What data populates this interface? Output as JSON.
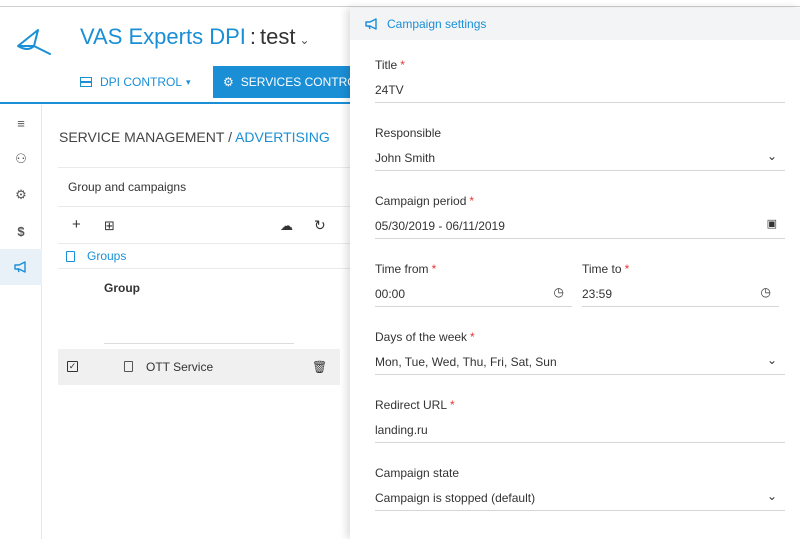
{
  "header": {
    "app_name": "VAS Experts DPI",
    "separator": ":",
    "instance": "test",
    "nav": {
      "dpi_control": "DPI CONTROL",
      "services_control": "SERVICES CONTROL"
    }
  },
  "rail": {
    "items": [
      "menu-icon",
      "users-icon",
      "services-icon",
      "dollar-icon",
      "megaphone-icon"
    ],
    "active": "megaphone-icon"
  },
  "breadcrumb": {
    "parent": "SERVICE MANAGEMENT",
    "separator": "/",
    "current": "ADVERTISING"
  },
  "panel": {
    "title": "Group and campaigns",
    "tree": {
      "groups_label": "Groups",
      "group_label": "Group",
      "service_label": "OTT Service"
    }
  },
  "drawer": {
    "title": "Campaign settings",
    "fields": {
      "title": {
        "label": "Title",
        "value": "24TV",
        "required": true
      },
      "responsible": {
        "label": "Responsible",
        "value": "John Smith",
        "required": false
      },
      "period": {
        "label": "Campaign period",
        "value": "05/30/2019 - 06/11/2019",
        "required": true
      },
      "time_from": {
        "label": "Time from",
        "value": "00:00",
        "required": true
      },
      "time_to": {
        "label": "Time to",
        "value": "23:59",
        "required": true
      },
      "days": {
        "label": "Days of the week",
        "value": "Mon, Tue, Wed, Thu, Fri, Sat, Sun",
        "required": true
      },
      "redirect": {
        "label": "Redirect URL",
        "value": "landing.ru",
        "required": true
      },
      "state": {
        "label": "Campaign state",
        "value": "Campaign is stopped (default)",
        "required": false
      }
    },
    "required_marker": "*"
  },
  "colors": {
    "accent": "#1a8fd6",
    "required": "#e53935"
  }
}
